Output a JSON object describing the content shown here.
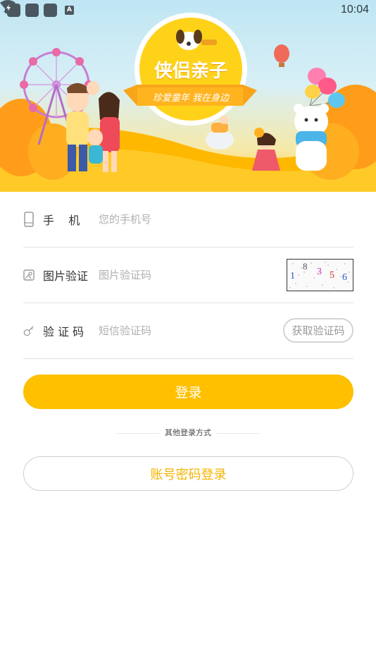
{
  "status_bar": {
    "time": "10:04",
    "notification_letter": "A"
  },
  "banner": {
    "logo_title": "侠侣亲子",
    "logo_ribbon": "珍爱童年 我在身边"
  },
  "form": {
    "phone": {
      "label": "手    机",
      "placeholder": "您的手机号"
    },
    "image_code": {
      "label": "图片验证",
      "placeholder": "图片验证码",
      "captcha_chars": [
        "1",
        "8",
        "3",
        "5",
        "6"
      ]
    },
    "sms_code": {
      "label": "验 证 码",
      "placeholder": "短信验证码",
      "button": "获取验证码"
    }
  },
  "login_button": "登录",
  "other_methods": "其他登录方式",
  "account_login_button": "账号密码登录",
  "colors": {
    "accent": "#ffc000",
    "account_text": "#f3b400",
    "divider": "#e2e2e2"
  }
}
